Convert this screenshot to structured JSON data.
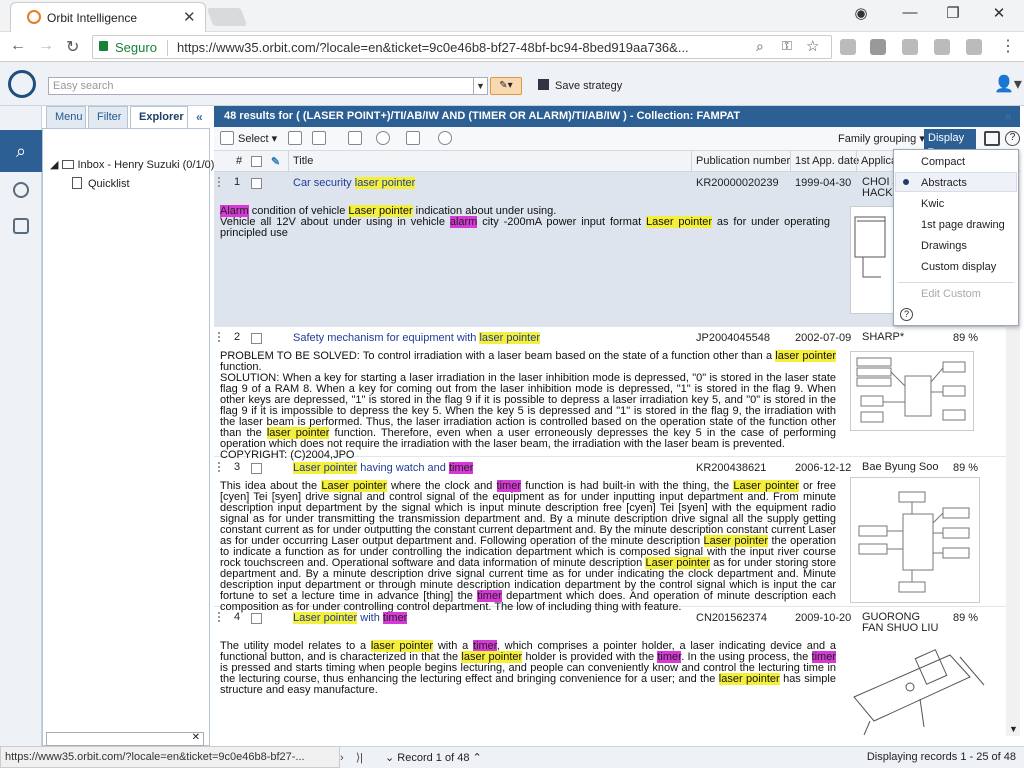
{
  "browser": {
    "tab_title": "Orbit Intelligence",
    "secure_label": "Seguro",
    "url": "https://www35.orbit.com/?locale=en&ticket=9c0e46b8-bf27-48bf-bc94-8bed919aa736&..."
  },
  "app": {
    "search_placeholder": "Easy search",
    "save_strategy": "Save strategy"
  },
  "side": {
    "tabs": [
      "Menu",
      "Filter",
      "Explorer"
    ],
    "inbox": "Inbox - Henry Suzuki (0/1/0)",
    "quicklist": "Quicklist"
  },
  "results_header": "48 results for ( (LASER POINT+)/TI/AB/IW AND (TIMER OR ALARM)/TI/AB/IW ) - Collection: FAMPAT",
  "toolbar": {
    "select": "Select",
    "family_grouping": "Family grouping",
    "display": "Display"
  },
  "columns": {
    "num": "#",
    "title": "Title",
    "pubnum": "Publication number",
    "firstapp": "1st App. date",
    "applicant": "Applica"
  },
  "rows": [
    {
      "num": "1",
      "title_pre": "Car security ",
      "title_hl": "laser pointer",
      "title_post": "",
      "pub": "KR20000020239",
      "date": "1999-04-30",
      "applicant": "CHOI J HACK",
      "score": ""
    },
    {
      "num": "2",
      "title_pre": "Safety mechanism for equipment with ",
      "title_hl": "laser pointer",
      "title_post": "",
      "pub": "JP2004045548",
      "date": "2002-07-09",
      "applicant": "SHARP*",
      "score": "89 %"
    },
    {
      "num": "3",
      "title_pre": "",
      "title_hl": "Laser pointer",
      "title_mid": " having watch and ",
      "title_hl2": "timer",
      "pub": "KR200438621",
      "date": "2006-12-12",
      "applicant": "Bae Byung Soo",
      "score": "89 %"
    },
    {
      "num": "4",
      "title_pre": "",
      "title_hl": "Laser pointer",
      "title_mid": " with ",
      "title_hl2": "timer",
      "pub": "CN201562374",
      "date": "2009-10-20",
      "applicant": "GUORONG FAN SHUO LIU",
      "score": "89 %"
    }
  ],
  "display_menu": {
    "items": [
      "Compact",
      "Abstracts",
      "Kwic",
      "1st page drawing",
      "Drawings",
      "Custom display"
    ],
    "edit_custom": "Edit Custom",
    "selected": "Abstracts"
  },
  "status": {
    "link": "https://www35.orbit.com/?locale=en&ticket=9c0e46b8-bf27-...",
    "record": "Record 1 of 48",
    "displaying": "Displaying records 1 - 25 of 48"
  },
  "colors": {
    "brand": "#2c5f93",
    "highlight_yellow": "#f4ef3b",
    "highlight_magenta": "#d63ad6"
  }
}
